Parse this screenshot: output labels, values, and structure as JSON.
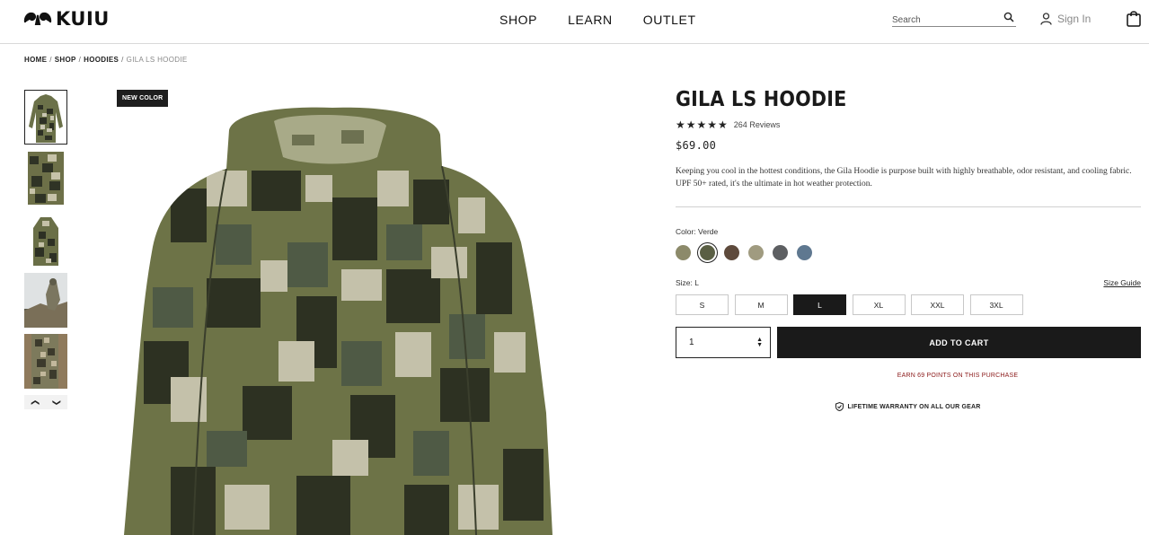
{
  "header": {
    "logo_text": "KUIU",
    "nav": [
      "SHOP",
      "LEARN",
      "OUTLET"
    ],
    "search_placeholder": "Search",
    "signin_label": "Sign In"
  },
  "breadcrumb": [
    "HOME",
    "SHOP",
    "HOODIES",
    "GILA LS HOODIE"
  ],
  "gallery": {
    "badge": "NEW COLOR",
    "thumbnails": [
      "thumb-1",
      "thumb-2",
      "thumb-3",
      "thumb-4",
      "thumb-5"
    ],
    "active_thumbnail": 0
  },
  "product": {
    "title": "GILA LS HOODIE",
    "rating_stars": 5,
    "reviews_label": "264 Reviews",
    "price": "$69.00",
    "description": "Keeping you cool in the hottest conditions, the Gila Hoodie is purpose built with highly breathable, odor resistant, and cooling fabric. UPF 50+ rated, it's the ultimate in hot weather protection.",
    "color_label": "Color: Verde",
    "swatches": [
      {
        "name": "swatch-1",
        "color": "#8c8a6a",
        "selected": false
      },
      {
        "name": "swatch-verde",
        "color": "#5a5f44",
        "selected": true
      },
      {
        "name": "swatch-3",
        "color": "#5e4a3c",
        "selected": false
      },
      {
        "name": "swatch-4",
        "color": "#a09b80",
        "selected": false
      },
      {
        "name": "swatch-5",
        "color": "#5d5f62",
        "selected": false
      },
      {
        "name": "swatch-6",
        "color": "#5f7890",
        "selected": false
      }
    ],
    "size_label": "Size: L",
    "size_guide_label": "Size Guide",
    "sizes": [
      "S",
      "M",
      "L",
      "XL",
      "XXL",
      "3XL"
    ],
    "selected_size": "L",
    "quantity": "1",
    "add_to_cart_label": "ADD TO CART",
    "points_label": "EARN 69 POINTS ON THIS PURCHASE",
    "warranty_label": "LIFETIME WARRANTY ON ALL OUR GEAR"
  }
}
